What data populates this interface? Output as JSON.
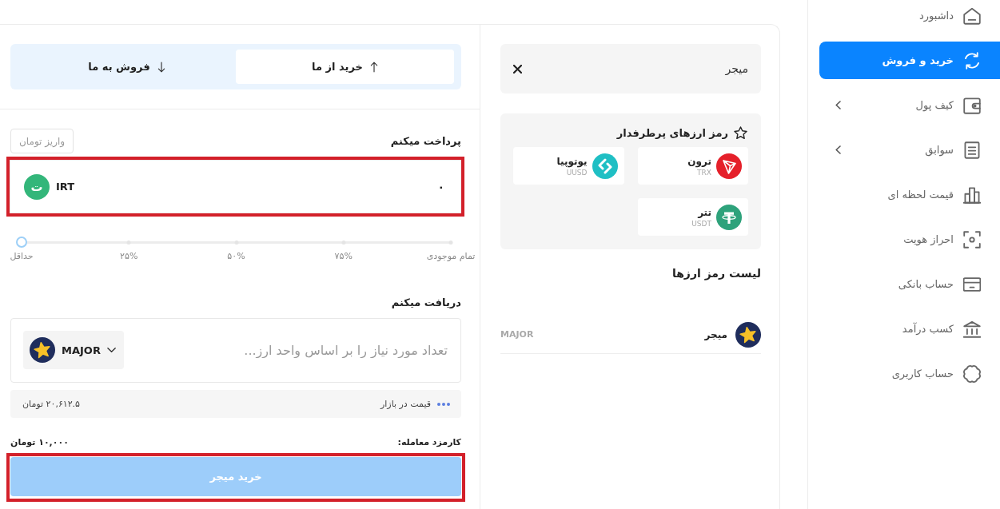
{
  "sidebar": {
    "items": [
      {
        "kind": "home",
        "label": "داشبورد",
        "selected": false,
        "expandable": false
      },
      {
        "kind": "swap",
        "label": "خرید و فروش",
        "selected": true,
        "expandable": false
      },
      {
        "kind": "wallet",
        "label": "کیف پول",
        "selected": false,
        "expandable": true
      },
      {
        "kind": "document",
        "label": "سوابق",
        "selected": false,
        "expandable": true
      },
      {
        "kind": "chart",
        "label": "قیمت لحظه ای",
        "selected": false,
        "expandable": false
      },
      {
        "kind": "scan",
        "label": "احراز هویت",
        "selected": false,
        "expandable": false
      },
      {
        "kind": "card",
        "label": "حساب بانکی",
        "selected": false,
        "expandable": false
      },
      {
        "kind": "bank",
        "label": "کسب درآمد",
        "selected": false,
        "expandable": false
      },
      {
        "kind": "badge",
        "label": "حساب کاربری",
        "selected": false,
        "expandable": false
      }
    ]
  },
  "market": {
    "search": {
      "value": "میجر"
    },
    "favorites": {
      "title": "رمز ارزهای پرطرفدار",
      "coins": [
        {
          "kind": "tron",
          "name": "ترون",
          "symbol": "TRX",
          "color": "#e5202a"
        },
        {
          "kind": "utopia",
          "name": "یوتوپیا",
          "symbol": "UUSD",
          "color": "#1fbfc4"
        },
        {
          "kind": "tether",
          "name": "تتر",
          "symbol": "USDT",
          "color": "#2ea27b"
        }
      ]
    },
    "list": {
      "title": "لیست رمز ارزها",
      "rows": [
        {
          "kind": "star",
          "name": "میجر",
          "symbol": "MAJOR"
        }
      ]
    }
  },
  "trade": {
    "tabs": [
      {
        "kind": "up",
        "label": "خرید از ما",
        "selected": true
      },
      {
        "kind": "down",
        "label": "فروش به ما",
        "selected": false
      }
    ],
    "pay": {
      "label": "پرداخت میکنم",
      "deposit_button": "واریز تومان",
      "value": "۰",
      "currency": "IRT",
      "currency_symbol": "ت",
      "highlighted": true
    },
    "slider": {
      "level": 0,
      "stops": [
        "تمام موجودی",
        "۷۵%",
        "۵۰%",
        "۲۵%",
        "حداقل"
      ]
    },
    "receive": {
      "label": "دریافت میکنم",
      "placeholder": "تعداد مورد نیاز را بر اساس واحد ارز...",
      "currency": "MAJOR"
    },
    "market_price": {
      "label": "قیمت در بازار",
      "value": "۲۰,۶۱۲.۵ تومان"
    },
    "fee": {
      "label": "کارمزد معامله:",
      "value": "۱۰,۰۰۰ تومان"
    },
    "buy_button": {
      "label": "خرید میجر",
      "disabled": true,
      "highlighted": true
    }
  }
}
